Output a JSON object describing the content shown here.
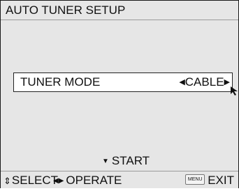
{
  "window": {
    "title": "AUTO TUNER SETUP"
  },
  "menu": {
    "items": [
      {
        "label": "TUNER MODE",
        "value": "CABLE",
        "left_arrow": "◀",
        "right_arrow": "▶"
      }
    ]
  },
  "action": {
    "start_arrow": "▼",
    "start_label": "START"
  },
  "footer": {
    "select_icon": "⇕",
    "select_label": "SELECT",
    "operate_icon": "◀▶",
    "operate_label": "OPERATE",
    "menu_key_label": "MENU",
    "exit_label": "EXIT"
  },
  "colors": {
    "background": "#e6e6e6",
    "highlight": "#ffffff",
    "text": "#111111"
  },
  "icons": [
    "pointer-cursor-icon",
    "up-down-arrow-icon",
    "left-right-arrow-icon",
    "menu-key-icon",
    "down-triangle-icon"
  ]
}
